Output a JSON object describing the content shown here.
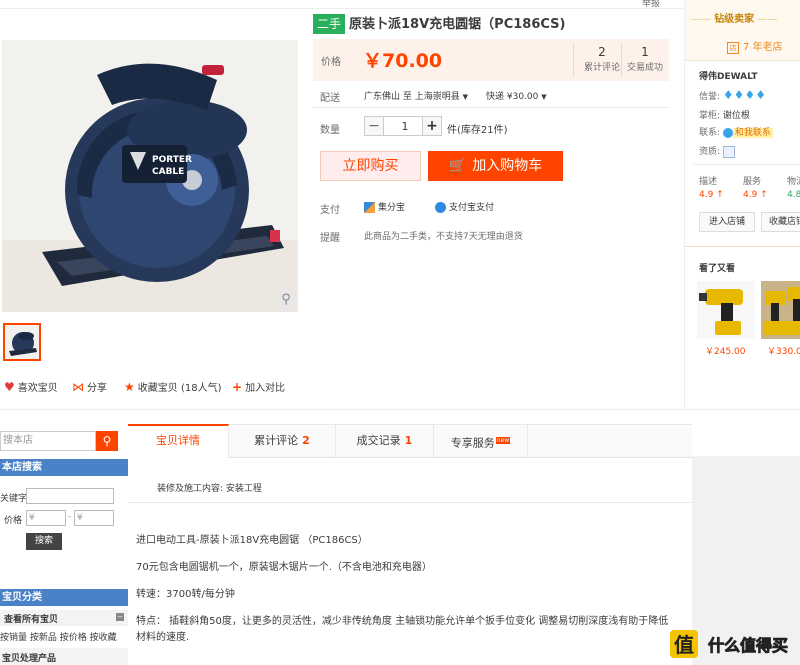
{
  "header": {
    "top_link": "举报"
  },
  "product": {
    "badge": "二手",
    "title": "原装卜派18V充电圆锯（PC186CS)",
    "price_label": "价格",
    "price": "￥70.00",
    "stats": [
      {
        "value": "2",
        "label": "累计评论"
      },
      {
        "value": "1",
        "label": "交易成功"
      }
    ],
    "shipping": {
      "label": "配送",
      "from": "广东佛山",
      "to_word": "至",
      "dest": "上海崇明县",
      "method": "快递 ¥30.00"
    },
    "quantity": {
      "label": "数量",
      "value": "1",
      "stock": "件(库存21件)"
    },
    "buy_label": "立即购买",
    "cart_label": "加入购物车",
    "payment": {
      "label": "支付",
      "option1": "集分宝",
      "option2": "支付宝支付"
    },
    "notice": {
      "label": "提醒",
      "text": "此商品为二手类，不支持7天无理由退货"
    },
    "image_text": {
      "brand_line1": "PORTER",
      "brand_line2": "CABLE"
    }
  },
  "actions": [
    {
      "label": "喜欢宝贝",
      "icon": "heart-icon",
      "symbol": "♥",
      "color": "#e4393c"
    },
    {
      "label": "分享",
      "icon": "share-icon",
      "symbol": "⋈",
      "color": "#f40"
    },
    {
      "label": "收藏宝贝 (18人气)",
      "icon": "star-icon",
      "symbol": "★",
      "color": "#f40"
    },
    {
      "label": "加入对比",
      "icon": "plus-icon",
      "symbol": "+",
      "color": "#f40"
    }
  ],
  "shop": {
    "level": "钻级卖家",
    "years": "7 年老店",
    "name": "得伟DEWALT",
    "credit_label": "信誉:",
    "credit_stars": "♦♦♦♦",
    "owner_label": "掌柜:",
    "owner": "谢位根",
    "contact_label": "联系:",
    "contact": "和我联系",
    "qual_label": "资质:",
    "ratings": [
      {
        "label": "描述",
        "value": "4.9 ↑"
      },
      {
        "label": "服务",
        "value": "4.9 ↑"
      },
      {
        "label": "物流",
        "value": "4.8"
      }
    ],
    "enter_btn": "进入店铺",
    "fav_btn": "收藏店铺",
    "also_viewed": "看了又看",
    "recs": [
      {
        "price": "￥245.00"
      },
      {
        "price": "￥330.0"
      }
    ]
  },
  "sidebar": {
    "search_placeholder": "搜本店",
    "store_search": "本店搜索",
    "keyword_label": "关键字",
    "price_label": "价格",
    "price_min": "¥",
    "price_max": "¥",
    "search_btn": "搜索",
    "category_head": "宝贝分类",
    "all_items": "查看所有宝贝",
    "sorts": "按销量 按新品 按价格 按收藏",
    "processing": "宝贝处理产品"
  },
  "tabs": [
    {
      "label": "宝贝详情",
      "count": ""
    },
    {
      "label": "累计评论",
      "count": "2"
    },
    {
      "label": "成交记录",
      "count": "1"
    },
    {
      "label": "专享服务",
      "count": "",
      "badge": "new"
    }
  ],
  "details": {
    "install": "装修及施工内容: 安装工程",
    "line1": "进口电动工具-原装卜派18V充电圆锯 （PC186CS）",
    "line2": "70元包含电圆锯机一个，原装锯木锯片一个.（不含电池和充电器）",
    "line3": "转速：3700转/每分钟",
    "line4": "特点：  插鞋斜角50度，让更多的灵活性，减少非传统角度 主轴锁功能允许单个扳手位变化 调整易切削深度浅有助于降低",
    "line5": "材料的速度."
  },
  "watermark": "什么值得买"
}
